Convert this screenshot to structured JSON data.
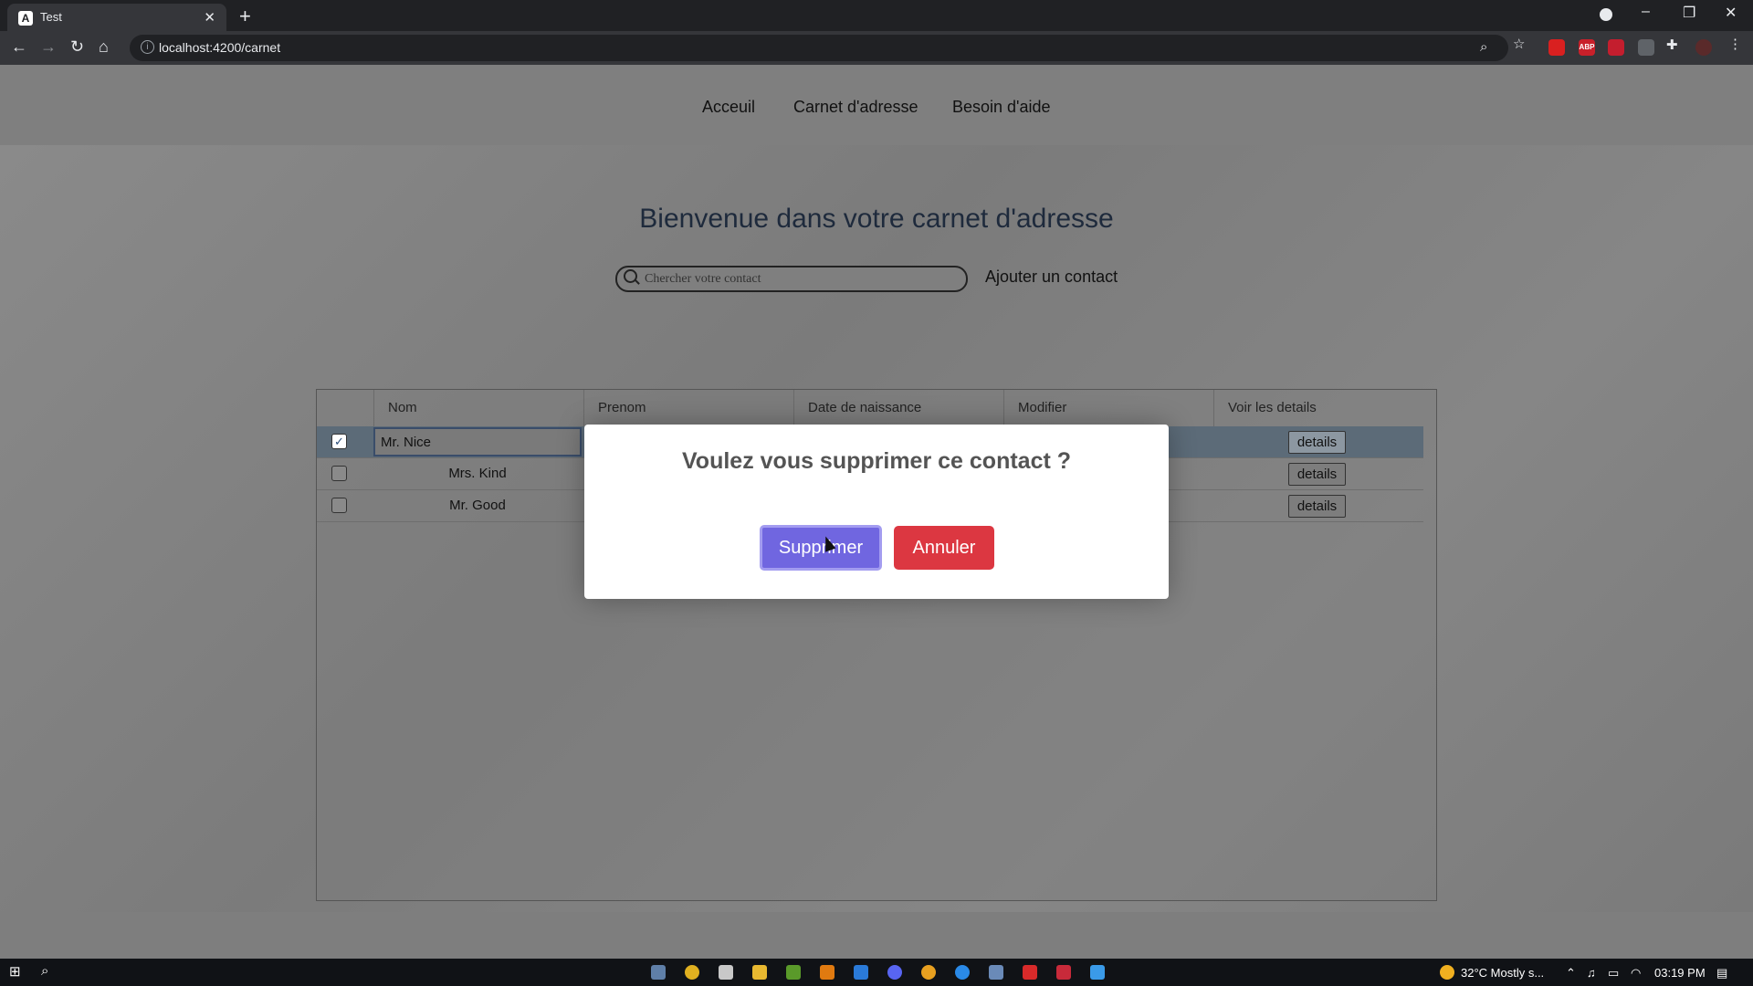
{
  "browser": {
    "tab_title": "Test",
    "tab_close": "✕",
    "new_tab": "+",
    "url": "localhost:4200/carnet",
    "window_controls": [
      "–",
      "❐",
      "✕"
    ]
  },
  "nav": {
    "items": [
      "Acceuil",
      "Carnet d'adresse",
      "Besoin d'aide"
    ]
  },
  "main": {
    "welcome": "Bienvenue dans votre carnet d'adresse",
    "search_placeholder": "Chercher votre contact",
    "add_contact": "Ajouter un contact"
  },
  "table": {
    "headers": [
      "Nom",
      "Prenom",
      "Date de naissance",
      "Modifier",
      "Voir les details"
    ],
    "rows": [
      {
        "nom": "Mr. Nice",
        "checked": true,
        "editing": true,
        "details": "details"
      },
      {
        "nom": "Mrs. Kind",
        "checked": false,
        "editing": false,
        "details": "details"
      },
      {
        "nom": "Mr. Good",
        "checked": false,
        "editing": false,
        "details": "details"
      }
    ]
  },
  "modal": {
    "title": "Voulez vous supprimer ce contact ?",
    "confirm_label": "Supprimer",
    "cancel_label": "Annuler",
    "confirm_color": "#7066e0",
    "cancel_color": "#dc3741"
  },
  "taskbar": {
    "weather": "32°C  Mostly s...",
    "time": "03:19 PM"
  }
}
